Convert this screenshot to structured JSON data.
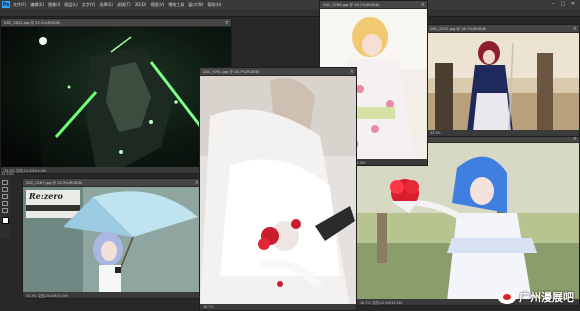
{
  "app": {
    "logo": "Ps",
    "menu": [
      "文件(F)",
      "编辑(E)",
      "图像(I)",
      "图层(L)",
      "文字(Y)",
      "选择(S)",
      "滤镜(T)",
      "3D(D)",
      "视图(V)",
      "增效工具",
      "窗口(W)",
      "帮助(H)"
    ],
    "window_controls": [
      "–",
      "□",
      "✕"
    ]
  },
  "windows": [
    {
      "id": "w1",
      "title": "DSC_9832.jpg @ 33.3%(RGB/8)",
      "status": "33.3%    文档:24.0M/24.0M"
    },
    {
      "id": "w2",
      "title": "DSC_0167.jpg @ 33.3%(RGB/8)",
      "status": "33.3%    文档:24.0M/24.0M"
    },
    {
      "id": "w3",
      "title": "DSC_9761.jpg @ 16.7%(RGB/8)",
      "status": "16.7%"
    },
    {
      "id": "w4",
      "title": "DSC_9768.jpg @ 16.7%(RGB/8)",
      "status": "16.7%    文档:24.0M/24.0M"
    },
    {
      "id": "w5",
      "title": "DSC_9752.jpg @ 16.7%(RGB/8)",
      "status": "16.7%"
    },
    {
      "id": "w6",
      "title": "DSC_0227.jpg @ 16.7%(RGB/8)",
      "status": "16.7%    文档:24.0M/24.0M"
    },
    {
      "id": "w7",
      "title": "DSC_9741.jpg @ 33.3%(RGB/8)",
      "status": "33.3%"
    }
  ],
  "side_status": "33.33%",
  "photo_text": {
    "brand": "Re:zero"
  },
  "watermark": "广州漫展吧"
}
